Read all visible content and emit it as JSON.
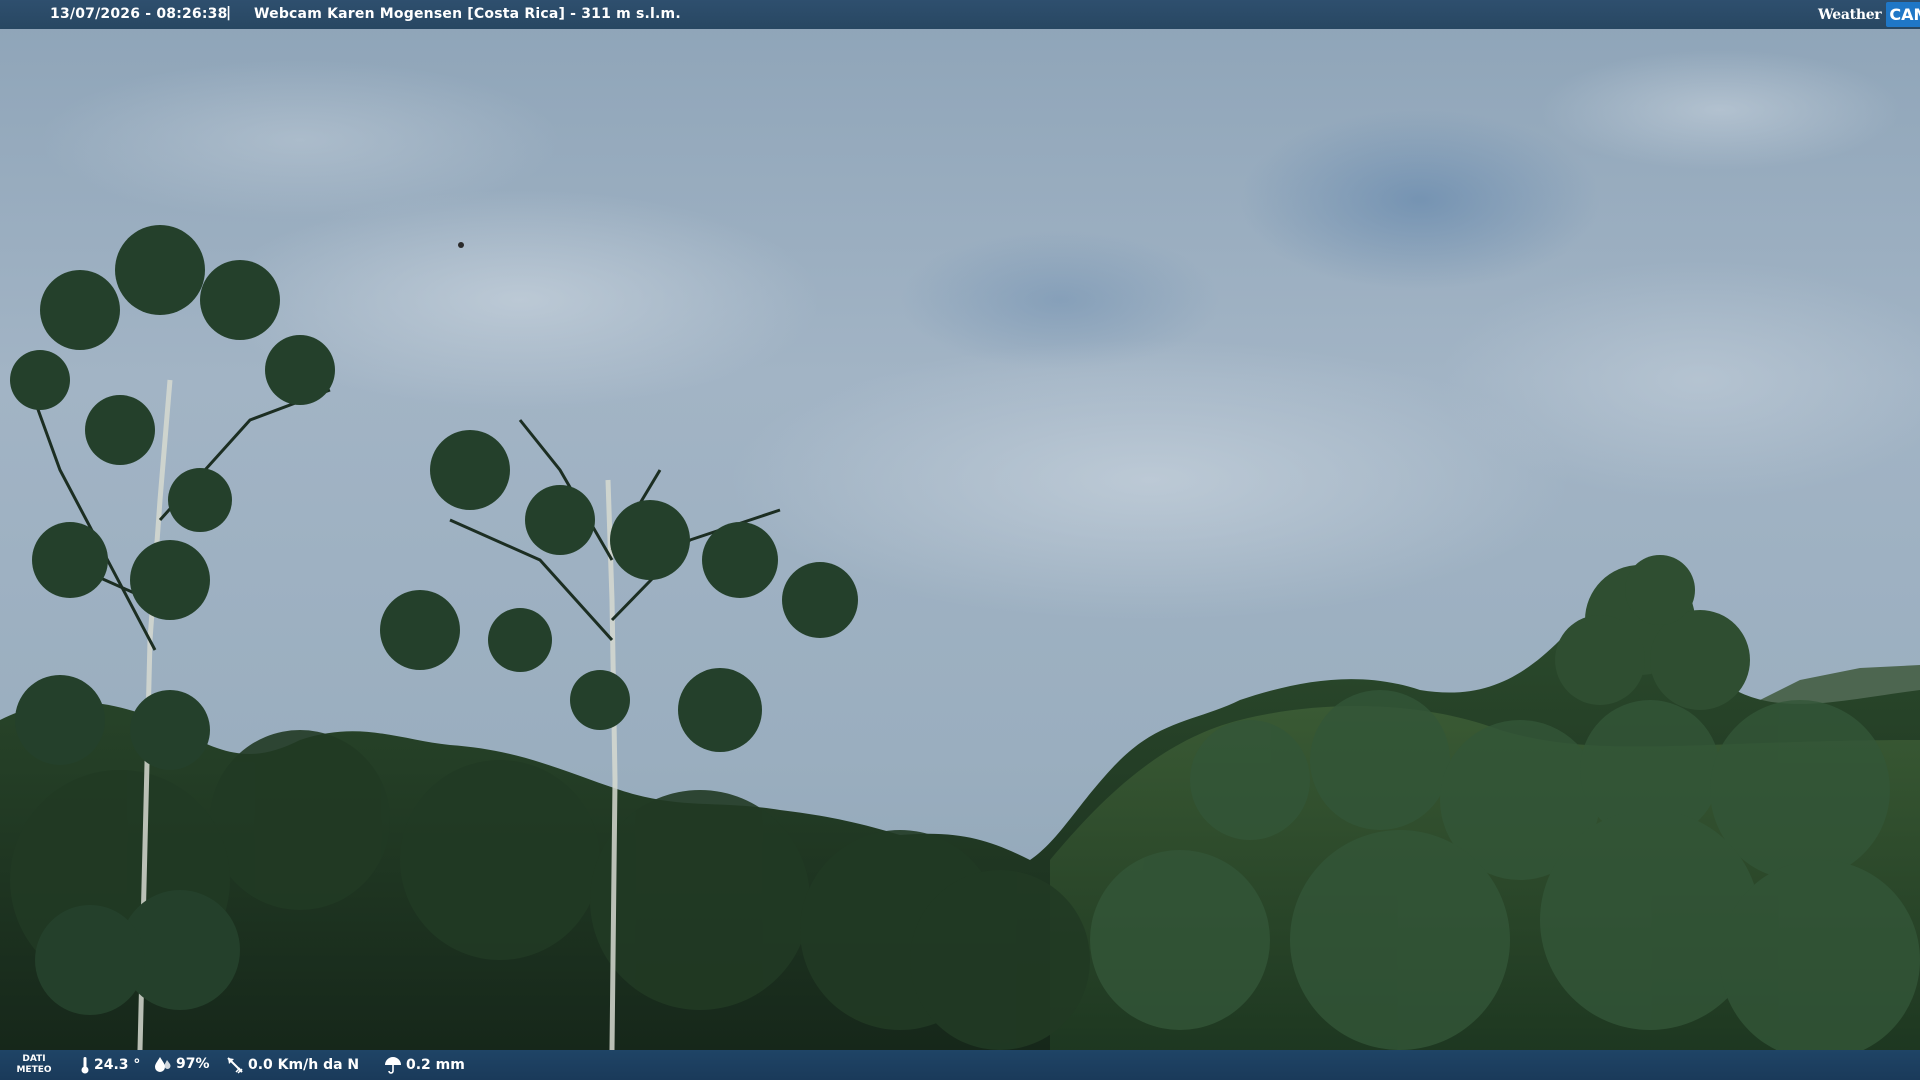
{
  "header": {
    "datetime": "13/07/2026 - 08:26:38",
    "separator": "|",
    "title": "Webcam Karen Mogensen [Costa Rica] - 311 m s.l.m."
  },
  "logo": {
    "weather_text": "Weather",
    "cam_text": "CAM"
  },
  "footer": {
    "meteo_label_line1": "DATI",
    "meteo_label_line2": "METEO",
    "temperature": "24.3 °",
    "humidity": "97%",
    "wind": "0.0 Km/h da N",
    "rain": "0.2 mm"
  },
  "icons": {
    "temperature": "thermometer-icon",
    "humidity": "water-drop-icon",
    "wind": "wind-vane-icon",
    "rain": "rain-umbrella-icon"
  },
  "colors": {
    "topbar": "#2a4a68",
    "bottombar": "#1c3d5e",
    "logo_accent": "#1f77c7"
  }
}
